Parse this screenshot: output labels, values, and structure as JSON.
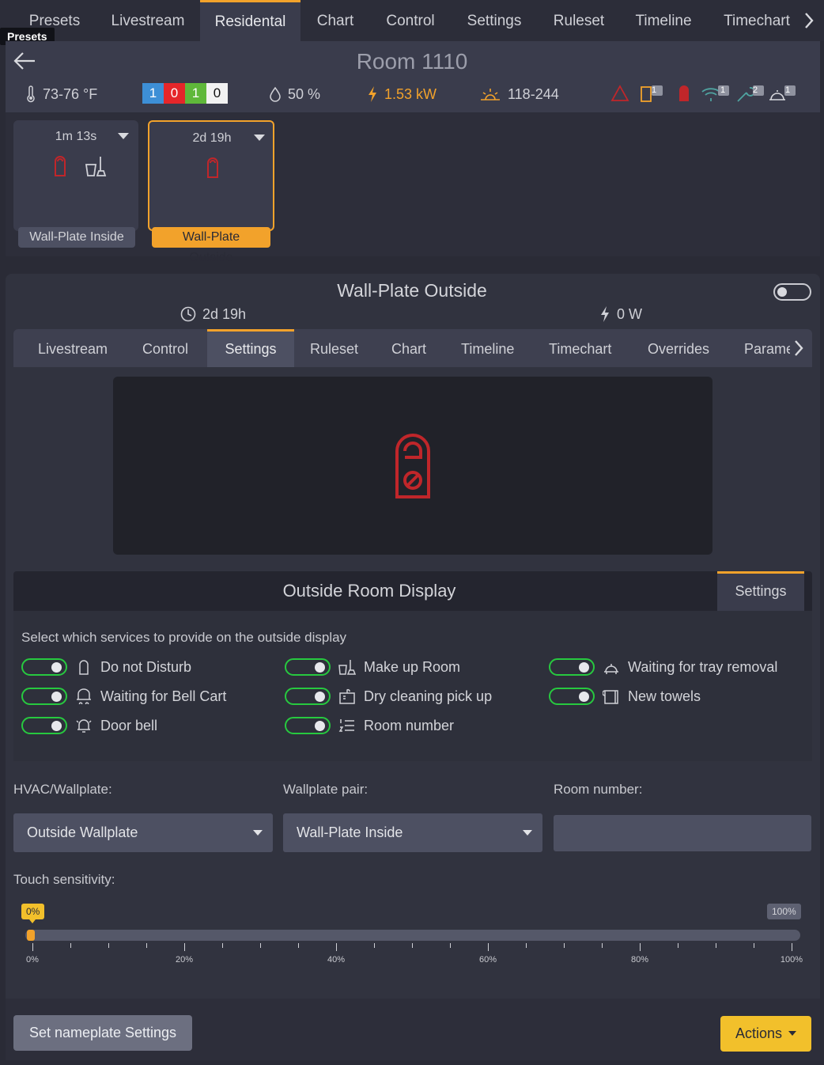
{
  "top_tabs": [
    "Presets",
    "Livestream",
    "Residental",
    "Chart",
    "Control",
    "Settings",
    "Ruleset",
    "Timeline",
    "Timechart"
  ],
  "tooltip": "Presets",
  "room": {
    "title": "Room 1110",
    "temperature": "73-76 °F",
    "counts": [
      {
        "value": "1",
        "color": "#3d8fd6"
      },
      {
        "value": "0",
        "color": "#e5262a"
      },
      {
        "value": "1",
        "color": "#5fb83a"
      },
      {
        "value": "0",
        "color": "#f2f2f2"
      }
    ],
    "humidity": "50 %",
    "power": "1.53 kW",
    "light": "118-244",
    "alert_badges": [
      "1",
      "1",
      "2",
      "1"
    ]
  },
  "devices": [
    {
      "time": "1m 13s",
      "label": "Wall-Plate Inside"
    },
    {
      "time": "2d 19h",
      "label": "Wall-Plate Outside"
    }
  ],
  "device": {
    "title": "Wall-Plate Outside",
    "uptime": "2d 19h",
    "power": "0 W"
  },
  "sub_tabs": [
    "Livestream",
    "Control",
    "Settings",
    "Ruleset",
    "Chart",
    "Timeline",
    "Timechart",
    "Overrides",
    "Parame"
  ],
  "outside_display": {
    "title": "Outside Room Display",
    "settings_tab": "Settings",
    "services_prompt": "Select which services to provide on the outside display",
    "services": [
      {
        "label": "Do not Disturb",
        "icon": "do-not-disturb-icon",
        "on": true
      },
      {
        "label": "Make up Room",
        "icon": "make-up-room-icon",
        "on": true
      },
      {
        "label": "Waiting for tray removal",
        "icon": "tray-icon",
        "on": true
      },
      {
        "label": "Waiting for Bell Cart",
        "icon": "bell-cart-icon",
        "on": true
      },
      {
        "label": "Dry cleaning pick up",
        "icon": "dry-cleaning-icon",
        "on": true
      },
      {
        "label": "New towels",
        "icon": "towel-icon",
        "on": true
      },
      {
        "label": "Door bell",
        "icon": "door-bell-icon",
        "on": true
      },
      {
        "label": "Room number",
        "icon": "room-number-icon",
        "on": true
      }
    ]
  },
  "fields": {
    "hvac_label": "HVAC/Wallplate:",
    "hvac_value": "Outside Wallplate",
    "pair_label": "Wallplate pair:",
    "pair_value": "Wall-Plate Inside",
    "room_number_label": "Room number:",
    "room_number_value": ""
  },
  "touch_sensitivity": {
    "label": "Touch sensitivity:",
    "value_label": "0%",
    "max_label": "100%",
    "value": 0,
    "ticks": [
      "0%",
      "20%",
      "40%",
      "60%",
      "80%",
      "100%"
    ]
  },
  "buttons": {
    "nameplate": "Set nameplate Settings",
    "actions": "Actions"
  },
  "colors": {
    "accent": "#f2a22b",
    "toggle_on": "#27c93f",
    "alert_red": "#c0262a"
  }
}
